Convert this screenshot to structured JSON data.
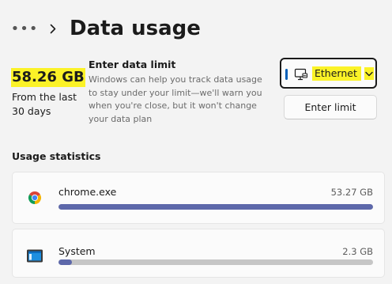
{
  "header": {
    "more_glyph": "•••",
    "title": "Data usage"
  },
  "summary": {
    "total": "58.26 GB",
    "period": "From the last 30 days"
  },
  "data_limit": {
    "title": "Enter data limit",
    "description": "Windows can help you track data usage to stay under your limit—we'll warn you when you're close, but it won't change your data plan",
    "network": {
      "selected": "Ethernet",
      "icon": "ethernet-icon"
    },
    "button_label": "Enter limit"
  },
  "usage_statistics": {
    "heading": "Usage statistics",
    "apps": [
      {
        "name": "chrome.exe",
        "usage": "53.27 GB",
        "fraction": 1.0,
        "icon": "chrome-icon"
      },
      {
        "name": "System",
        "usage": "2.3 GB",
        "fraction": 0.043,
        "icon": "system-icon"
      }
    ]
  },
  "colors": {
    "highlight": "#fbf227",
    "accent": "#005fb8",
    "bar_fill": "#5d68aa",
    "bar_track": "#c6c6c6"
  }
}
